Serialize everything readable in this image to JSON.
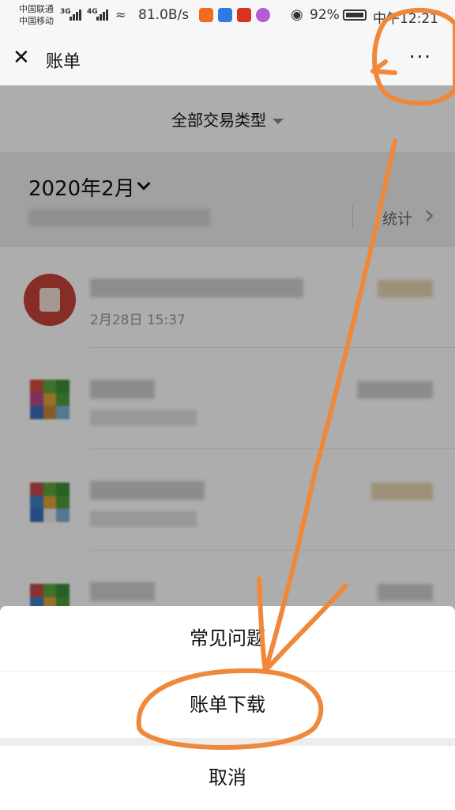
{
  "status_bar": {
    "carrier1": "中国联通",
    "carrier2": "中国移动",
    "net1": "3G",
    "net2": "4G",
    "speed": "81.0B/s",
    "battery": "92%",
    "time": "中午12:21"
  },
  "nav": {
    "title": "账单",
    "more_label": "···"
  },
  "filter": {
    "label": "全部交易类型"
  },
  "summary": {
    "month": "2020年2月",
    "stat_label": "统计"
  },
  "transactions": [
    {
      "date": "2月28日 15:37"
    }
  ],
  "action_sheet": {
    "items": [
      "常见问题",
      "账单下载",
      "取消"
    ]
  },
  "colors": {
    "annotation": "#f0883a",
    "overlay": "rgba(0,0,0,0.32)"
  }
}
